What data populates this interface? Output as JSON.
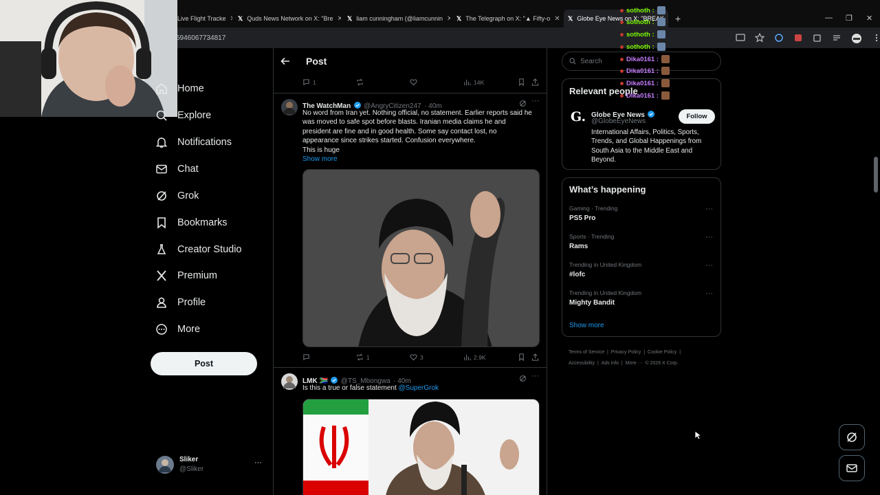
{
  "browser": {
    "tabs": [
      {
        "label": "Live Flight Tracke"
      },
      {
        "label": "Quds News Network on X: \"Bre"
      },
      {
        "label": "liam cunningham (@liamcunnin"
      },
      {
        "label": "The Telegraph on X: \"▲ Fifty-o"
      },
      {
        "label": "Globe Eye News on X: \"BREAK"
      }
    ],
    "url": "5946067734817"
  },
  "sidebar": {
    "items": [
      {
        "label": "Home",
        "icon": "home-icon"
      },
      {
        "label": "Explore",
        "icon": "search-icon"
      },
      {
        "label": "Notifications",
        "icon": "bell-icon"
      },
      {
        "label": "Chat",
        "icon": "mail-icon"
      },
      {
        "label": "Grok",
        "icon": "grok-icon"
      },
      {
        "label": "Bookmarks",
        "icon": "bookmark-icon"
      },
      {
        "label": "Creator Studio",
        "icon": "flask-icon"
      },
      {
        "label": "Premium",
        "icon": "x-logo-icon"
      },
      {
        "label": "Profile",
        "icon": "person-icon"
      },
      {
        "label": "More",
        "icon": "more-circle-icon"
      }
    ],
    "post_button": "Post",
    "account": {
      "name": "Sliker",
      "handle": "@Sliker"
    }
  },
  "main": {
    "header": {
      "title": "Post"
    },
    "prev_actions": {
      "replies": "1",
      "reposts": "",
      "likes": "",
      "views": "14K"
    },
    "posts": [
      {
        "author": "The WatchMan",
        "handle": "@AngryCitizen247",
        "time": "· 40m",
        "text_lines": [
          "No word from Iran yet. Nothing official, no statement. Earlier reports said he",
          "was moved to safe spot before blasts. Iranian media claims he and",
          "president are fine and in good health. Some say contact lost, no",
          "appearance since strikes started. Confusion everywhere.",
          "This is huge"
        ],
        "show_more": "Show more",
        "actions": {
          "replies": "",
          "reposts": "1",
          "likes": "3",
          "views": "2.9K"
        }
      },
      {
        "author": "LMK 🇿🇦",
        "handle": "@TS_Mbongwa",
        "time": "· 40m",
        "text": "Is this a true or false statement ",
        "mention": "@SuperGrok"
      }
    ]
  },
  "right": {
    "search_placeholder": "Search",
    "relevant": {
      "title": "Relevant people",
      "name": "Globe Eye News",
      "handle": "@GlobeEyeNews",
      "follow": "Follow",
      "bio_lines": [
        "International Affairs, Politics, Sports,",
        "Trends, and Global Happenings from",
        "South Asia to the Middle East and",
        "Beyond."
      ]
    },
    "happening": {
      "title": "What’s happening",
      "trends": [
        {
          "category": "Gaming · Trending",
          "name": "PS5 Pro"
        },
        {
          "category": "Sports · Trending",
          "name": "Rams"
        },
        {
          "category": "Trending in United Kingdom",
          "name": "#lofc"
        },
        {
          "category": "Trending in United Kingdom",
          "name": "Mighty Bandit"
        }
      ],
      "show_more": "Show more"
    },
    "footer": [
      "Terms of Service",
      "|",
      "Privacy Policy",
      "|",
      "Cookie Policy",
      "|",
      "Accessibility",
      "|",
      "Ads info",
      "|",
      "More ···",
      "© 2026 X Corp."
    ]
  },
  "chat": [
    {
      "user": "sothoth :",
      "color": "#7cfc00"
    },
    {
      "user": "sothoth :",
      "color": "#7cfc00"
    },
    {
      "user": "sothoth :",
      "color": "#7cfc00"
    },
    {
      "user": "sothoth :",
      "color": "#7cfc00"
    },
    {
      "user": "Dika0161 :",
      "color": "#c77dff"
    },
    {
      "user": "Dika0161 :",
      "color": "#c77dff"
    },
    {
      "user": "Dika0161 :",
      "color": "#c77dff"
    },
    {
      "user": "Dika0161 :",
      "color": "#c77dff"
    }
  ]
}
